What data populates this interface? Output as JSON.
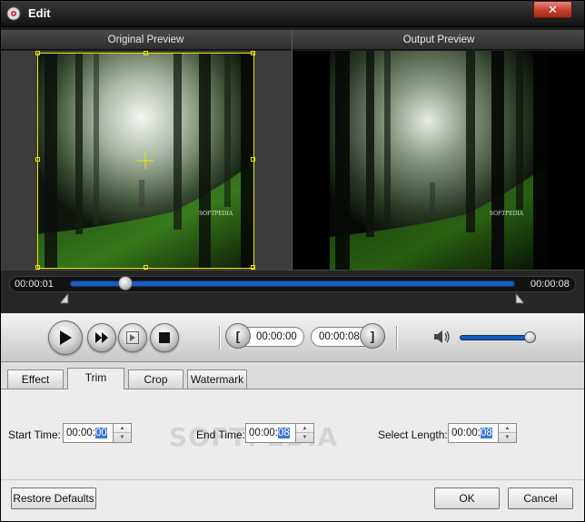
{
  "window": {
    "title": "Edit",
    "close_label": "✕"
  },
  "preview": {
    "original_label": "Original Preview",
    "output_label": "Output Preview",
    "image_caption": "SOFTPEDIA"
  },
  "timeline": {
    "current_time": "00:00:01",
    "total_time": "00:00:08",
    "position_fraction": 0.12
  },
  "controls": {
    "trim_start": "00:00:00",
    "trim_end": "00:00:08",
    "volume_fraction": 0.95
  },
  "tabs": [
    {
      "label": "Effect",
      "active": false
    },
    {
      "label": "Trim",
      "active": true
    },
    {
      "label": "Crop",
      "active": false
    },
    {
      "label": "Watermark",
      "active": false
    }
  ],
  "trim": {
    "start_label": "Start Time:",
    "start_prefix": "00:00:",
    "start_sel": "00",
    "end_label": "End Time:",
    "end_prefix": "00:00:",
    "end_sel": "08",
    "length_label": "Select Length:",
    "length_prefix": "00:00:",
    "length_sel": "08"
  },
  "watermark_text": "SOFTPEDIA",
  "footer": {
    "restore_label": "Restore Defaults",
    "ok_label": "OK",
    "cancel_label": "Cancel"
  },
  "colors": {
    "accent": "#1a5cc0",
    "crop_frame": "#e8e800",
    "selection": "#3a78d8"
  },
  "icons": [
    "app-icon",
    "close-icon",
    "play-icon",
    "next-frame-icon",
    "clip-icon",
    "stop-icon",
    "volume-icon"
  ]
}
